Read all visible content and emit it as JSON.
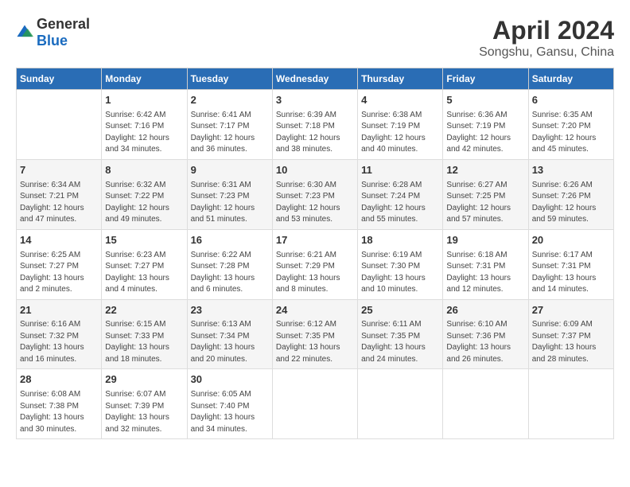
{
  "logo": {
    "general": "General",
    "blue": "Blue"
  },
  "title": "April 2024",
  "subtitle": "Songshu, Gansu, China",
  "days_of_week": [
    "Sunday",
    "Monday",
    "Tuesday",
    "Wednesday",
    "Thursday",
    "Friday",
    "Saturday"
  ],
  "weeks": [
    [
      {
        "day": "",
        "info": ""
      },
      {
        "day": "1",
        "info": "Sunrise: 6:42 AM\nSunset: 7:16 PM\nDaylight: 12 hours\nand 34 minutes."
      },
      {
        "day": "2",
        "info": "Sunrise: 6:41 AM\nSunset: 7:17 PM\nDaylight: 12 hours\nand 36 minutes."
      },
      {
        "day": "3",
        "info": "Sunrise: 6:39 AM\nSunset: 7:18 PM\nDaylight: 12 hours\nand 38 minutes."
      },
      {
        "day": "4",
        "info": "Sunrise: 6:38 AM\nSunset: 7:19 PM\nDaylight: 12 hours\nand 40 minutes."
      },
      {
        "day": "5",
        "info": "Sunrise: 6:36 AM\nSunset: 7:19 PM\nDaylight: 12 hours\nand 42 minutes."
      },
      {
        "day": "6",
        "info": "Sunrise: 6:35 AM\nSunset: 7:20 PM\nDaylight: 12 hours\nand 45 minutes."
      }
    ],
    [
      {
        "day": "7",
        "info": "Sunrise: 6:34 AM\nSunset: 7:21 PM\nDaylight: 12 hours\nand 47 minutes."
      },
      {
        "day": "8",
        "info": "Sunrise: 6:32 AM\nSunset: 7:22 PM\nDaylight: 12 hours\nand 49 minutes."
      },
      {
        "day": "9",
        "info": "Sunrise: 6:31 AM\nSunset: 7:23 PM\nDaylight: 12 hours\nand 51 minutes."
      },
      {
        "day": "10",
        "info": "Sunrise: 6:30 AM\nSunset: 7:23 PM\nDaylight: 12 hours\nand 53 minutes."
      },
      {
        "day": "11",
        "info": "Sunrise: 6:28 AM\nSunset: 7:24 PM\nDaylight: 12 hours\nand 55 minutes."
      },
      {
        "day": "12",
        "info": "Sunrise: 6:27 AM\nSunset: 7:25 PM\nDaylight: 12 hours\nand 57 minutes."
      },
      {
        "day": "13",
        "info": "Sunrise: 6:26 AM\nSunset: 7:26 PM\nDaylight: 12 hours\nand 59 minutes."
      }
    ],
    [
      {
        "day": "14",
        "info": "Sunrise: 6:25 AM\nSunset: 7:27 PM\nDaylight: 13 hours\nand 2 minutes."
      },
      {
        "day": "15",
        "info": "Sunrise: 6:23 AM\nSunset: 7:27 PM\nDaylight: 13 hours\nand 4 minutes."
      },
      {
        "day": "16",
        "info": "Sunrise: 6:22 AM\nSunset: 7:28 PM\nDaylight: 13 hours\nand 6 minutes."
      },
      {
        "day": "17",
        "info": "Sunrise: 6:21 AM\nSunset: 7:29 PM\nDaylight: 13 hours\nand 8 minutes."
      },
      {
        "day": "18",
        "info": "Sunrise: 6:19 AM\nSunset: 7:30 PM\nDaylight: 13 hours\nand 10 minutes."
      },
      {
        "day": "19",
        "info": "Sunrise: 6:18 AM\nSunset: 7:31 PM\nDaylight: 13 hours\nand 12 minutes."
      },
      {
        "day": "20",
        "info": "Sunrise: 6:17 AM\nSunset: 7:31 PM\nDaylight: 13 hours\nand 14 minutes."
      }
    ],
    [
      {
        "day": "21",
        "info": "Sunrise: 6:16 AM\nSunset: 7:32 PM\nDaylight: 13 hours\nand 16 minutes."
      },
      {
        "day": "22",
        "info": "Sunrise: 6:15 AM\nSunset: 7:33 PM\nDaylight: 13 hours\nand 18 minutes."
      },
      {
        "day": "23",
        "info": "Sunrise: 6:13 AM\nSunset: 7:34 PM\nDaylight: 13 hours\nand 20 minutes."
      },
      {
        "day": "24",
        "info": "Sunrise: 6:12 AM\nSunset: 7:35 PM\nDaylight: 13 hours\nand 22 minutes."
      },
      {
        "day": "25",
        "info": "Sunrise: 6:11 AM\nSunset: 7:35 PM\nDaylight: 13 hours\nand 24 minutes."
      },
      {
        "day": "26",
        "info": "Sunrise: 6:10 AM\nSunset: 7:36 PM\nDaylight: 13 hours\nand 26 minutes."
      },
      {
        "day": "27",
        "info": "Sunrise: 6:09 AM\nSunset: 7:37 PM\nDaylight: 13 hours\nand 28 minutes."
      }
    ],
    [
      {
        "day": "28",
        "info": "Sunrise: 6:08 AM\nSunset: 7:38 PM\nDaylight: 13 hours\nand 30 minutes."
      },
      {
        "day": "29",
        "info": "Sunrise: 6:07 AM\nSunset: 7:39 PM\nDaylight: 13 hours\nand 32 minutes."
      },
      {
        "day": "30",
        "info": "Sunrise: 6:05 AM\nSunset: 7:40 PM\nDaylight: 13 hours\nand 34 minutes."
      },
      {
        "day": "",
        "info": ""
      },
      {
        "day": "",
        "info": ""
      },
      {
        "day": "",
        "info": ""
      },
      {
        "day": "",
        "info": ""
      }
    ]
  ]
}
